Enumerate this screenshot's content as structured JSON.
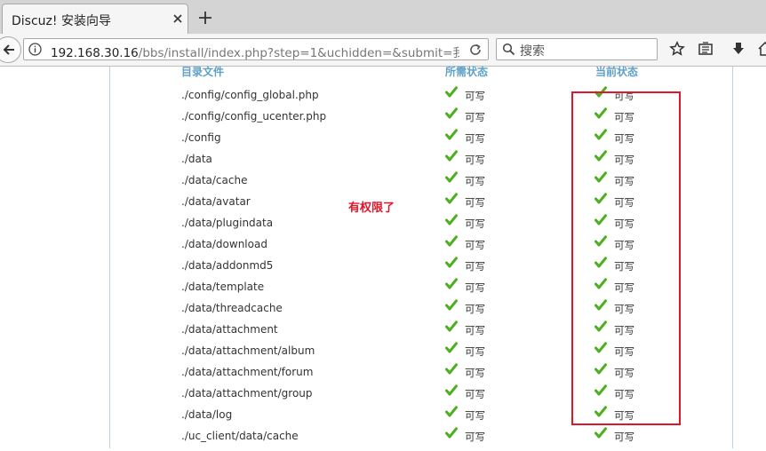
{
  "browser": {
    "tab_title": "Discuz! 安装向导",
    "url_host": "192.168.30.16",
    "url_path": "/bbs/install/index.php?step=1&uchidden=&submit=我",
    "search_placeholder": "搜索"
  },
  "table": {
    "headers": [
      "目录文件",
      "所需状态",
      "当前状态"
    ],
    "rows": [
      {
        "path": "./config/config_global.php",
        "required": "可写",
        "current": "可写"
      },
      {
        "path": "./config/config_ucenter.php",
        "required": "可写",
        "current": "可写"
      },
      {
        "path": "./config",
        "required": "可写",
        "current": "可写"
      },
      {
        "path": "./data",
        "required": "可写",
        "current": "可写"
      },
      {
        "path": "./data/cache",
        "required": "可写",
        "current": "可写"
      },
      {
        "path": "./data/avatar",
        "required": "可写",
        "current": "可写"
      },
      {
        "path": "./data/plugindata",
        "required": "可写",
        "current": "可写"
      },
      {
        "path": "./data/download",
        "required": "可写",
        "current": "可写"
      },
      {
        "path": "./data/addonmd5",
        "required": "可写",
        "current": "可写"
      },
      {
        "path": "./data/template",
        "required": "可写",
        "current": "可写"
      },
      {
        "path": "./data/threadcache",
        "required": "可写",
        "current": "可写"
      },
      {
        "path": "./data/attachment",
        "required": "可写",
        "current": "可写"
      },
      {
        "path": "./data/attachment/album",
        "required": "可写",
        "current": "可写"
      },
      {
        "path": "./data/attachment/forum",
        "required": "可写",
        "current": "可写"
      },
      {
        "path": "./data/attachment/group",
        "required": "可写",
        "current": "可写"
      },
      {
        "path": "./data/log",
        "required": "可写",
        "current": "可写"
      },
      {
        "path": "./uc_client/data/cache",
        "required": "可写",
        "current": "可写"
      }
    ]
  },
  "annotation": {
    "text": "有权限了",
    "color": "#e0162b"
  },
  "colors": {
    "check": "#4caf1e",
    "header": "#5fa0c8"
  }
}
